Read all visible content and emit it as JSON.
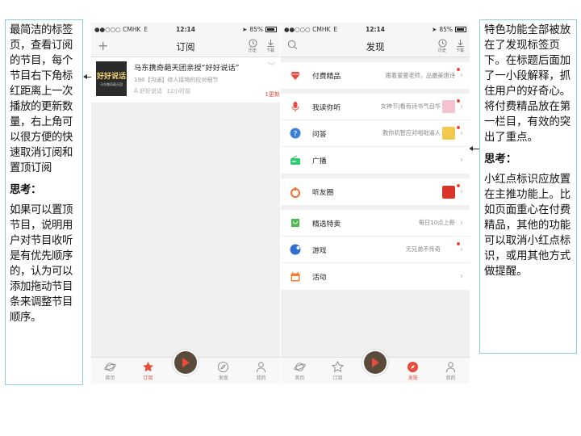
{
  "left_note": {
    "paragraph": "最简洁的标签页，查看订阅的节目，每个节目右下角标红距离上一次播放的更新数量，右上角可以很方便的快速取消订阅和置顶订阅",
    "heading": "思考：",
    "thinking": "如果可以置顶节目，说明用户对节目收听是有优先顺序的，认为可以添加拖动节目条来调整节目顺序。"
  },
  "right_note": {
    "paragraph": "特色功能全部被放在了发现标签页下。在标题后面加了一小段解释，抓住用户的好奇心。将付费精品放在第一栏目，有效的突出了重点。",
    "heading": "思考：",
    "thinking": "小红点标识应放置在主推功能上。比如页面重心在付费精品，其他的功能可以取消小红点标识，或用其他方式做提醒。"
  },
  "status_bar": {
    "carrier": "●●○○○ CMHK",
    "network": "E",
    "time": "12:14",
    "battery": "85%"
  },
  "subscribe_screen": {
    "title": "订阅",
    "history_label": "历史",
    "download_label": "下载",
    "item": {
      "cover_title": "好好说话",
      "cover_caption": "马东携奇葩天团",
      "title": "马东携奇葩天团亲授“好好说话”",
      "episode": "198【沟通】待人接物的应对细节",
      "meta_source": "好好说话",
      "meta_time": "12小时前",
      "update_badge": "1更新"
    }
  },
  "discover_screen": {
    "title": "发现",
    "history_label": "历史",
    "download_label": "下载",
    "groups": [
      [
        {
          "label": "付费精品",
          "desc": "跟着蒙曼老师，品最美唐诗",
          "icon": "diamond-icon",
          "color": "#e74c3c",
          "dot": true
        }
      ],
      [
        {
          "label": "我读你听",
          "desc": "女神节|看有诗书气自华",
          "icon": "microphone-icon",
          "color": "#e74c3c",
          "dot": true
        },
        {
          "label": "问答",
          "desc": "教你机智应对咄咄逼人",
          "icon": "question-icon",
          "color": "#3b82d6",
          "dot": true
        },
        {
          "label": "广播",
          "desc": "",
          "icon": "radio-icon",
          "color": "#2ecc71",
          "dot": false
        }
      ],
      [
        {
          "label": "听友圈",
          "desc": "",
          "icon": "circle-icon",
          "color": "#f07030",
          "dot": true
        }
      ],
      [
        {
          "label": "精选特卖",
          "desc": "每日10点上新",
          "icon": "bag-icon",
          "color": "#4cbb4c",
          "dot": false
        },
        {
          "label": "游戏",
          "desc": "无兄弟不传奇",
          "icon": "gamepad-icon",
          "color": "#2f6fd0",
          "dot": true
        },
        {
          "label": "活动",
          "desc": "",
          "icon": "calendar-icon",
          "color": "#f08030",
          "dot": false
        }
      ]
    ]
  },
  "tabbar": {
    "home": "首页",
    "subscribe": "订阅",
    "discover": "发现",
    "me": "我的"
  },
  "colors": {
    "accent": "#e74c3c",
    "note_border": "#8fd0e0"
  }
}
